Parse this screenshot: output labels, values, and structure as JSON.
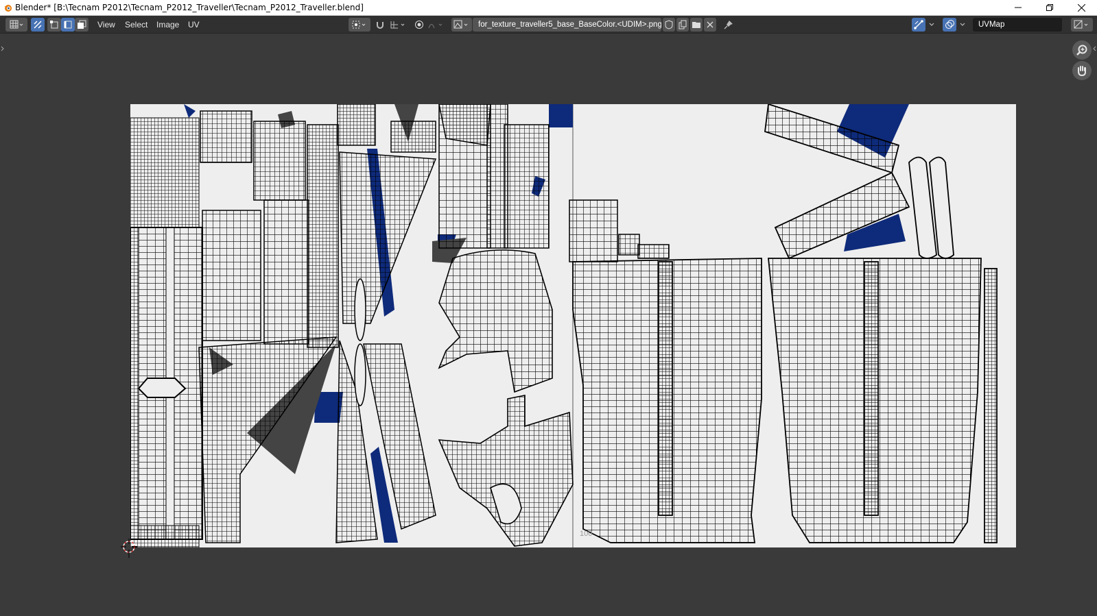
{
  "window": {
    "title": "Blender* [B:\\Tecnam P2012\\Tecnam_P2012_Traveller\\Tecnam_P2012_Traveller.blend]",
    "controls": [
      "minimize-icon",
      "restore-icon",
      "close-icon"
    ]
  },
  "header": {
    "menus": [
      "View",
      "Select",
      "Image",
      "UV"
    ],
    "image_name": "for_texture_traveller5_base_BaseColor.<UDIM>.png",
    "uv_map": "UVMap",
    "icons": [
      "editor-type-icon",
      "uv-sync-icon",
      "vertex-select-icon",
      "edge-select-icon",
      "face-select-icon",
      "pivot-icon",
      "snap-icon",
      "snap-target-icon",
      "proportional-edit-icon",
      "falloff-icon",
      "image-browse-icon",
      "fake-user-icon",
      "duplicate-image-icon",
      "open-image-icon",
      "unlink-image-icon",
      "pin-icon",
      "gizmo-icon",
      "overlay-icon",
      "display-channels-icon"
    ]
  },
  "viewport": {
    "udim_tile_label": "100",
    "gizmos": [
      "zoom-icon",
      "pan-hand-icon"
    ],
    "cursor": "2d-cursor-icon"
  },
  "colors": {
    "background": "#3a3a3a",
    "header": "#303030",
    "active_button": "#4772b3",
    "canvas": "#eeeeee",
    "wire": "#000000",
    "texture_blue": "#0e2a7a"
  }
}
